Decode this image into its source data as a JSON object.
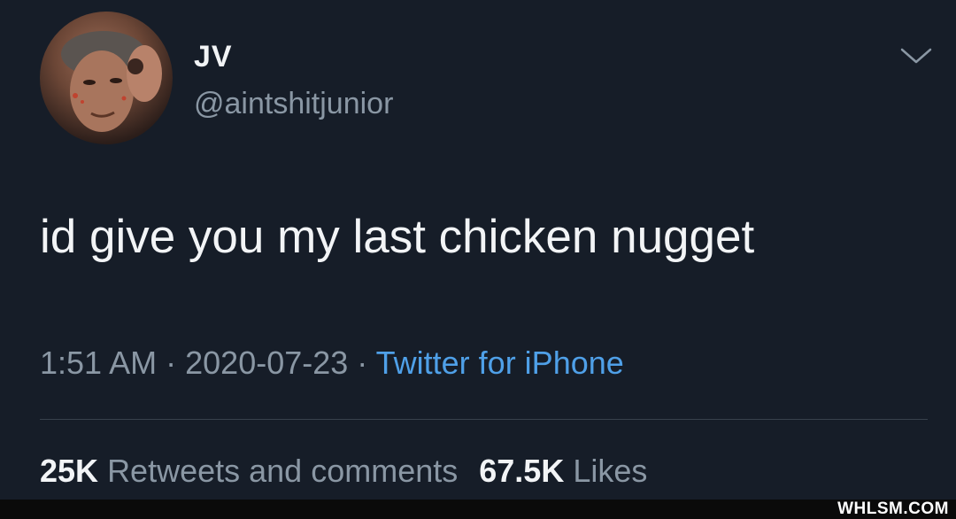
{
  "tweet": {
    "display_name": "JV",
    "handle": "@aintshitjunior",
    "text": "id give you my last chicken nugget",
    "time": "1:51 AM",
    "date": "2020-07-23",
    "separator": "·",
    "source": "Twitter for iPhone",
    "retweets_count": "25K",
    "retweets_label": "Retweets and comments",
    "likes_count": "67.5K",
    "likes_label": "Likes",
    "menu_icon": "chevron-down-icon"
  },
  "watermark": "WHLSM.COM",
  "colors": {
    "background": "#161d28",
    "primary_text": "#f2f4f6",
    "secondary_text": "#8a97a4",
    "link": "#4fa0e8",
    "divider": "#38414d"
  }
}
